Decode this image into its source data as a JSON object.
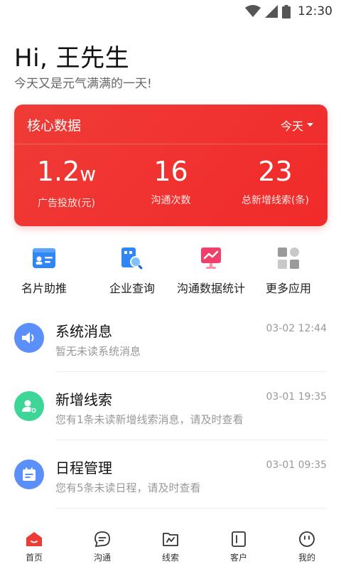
{
  "status_bar": {
    "time": "12:30"
  },
  "header": {
    "greeting": "Hi, 王先生",
    "subtitle": "今天又是元气满满的一天!"
  },
  "core_data": {
    "title": "核心数据",
    "period": "今天",
    "stats": [
      {
        "value": "1.2",
        "unit": "w",
        "label": "广告投放(元)"
      },
      {
        "value": "16",
        "unit": "",
        "label": "沟通次数"
      },
      {
        "value": "23",
        "unit": "",
        "label": "总新增线索(条)"
      }
    ]
  },
  "apps": [
    {
      "label": "名片助推",
      "icon": "business-card-icon"
    },
    {
      "label": "企业查询",
      "icon": "company-search-icon"
    },
    {
      "label": "沟通数据统计",
      "icon": "chart-stats-icon"
    },
    {
      "label": "更多应用",
      "icon": "more-apps-icon"
    }
  ],
  "messages": [
    {
      "title": "系统消息",
      "time": "03-02 12:44",
      "desc": "暂无未读系统消息",
      "icon": "speaker-icon",
      "color": "#5b8ff9"
    },
    {
      "title": "新增线索",
      "time": "03-01 19:35",
      "desc": "您有1条未读新增线索消息，请及时查看",
      "icon": "user-add-icon",
      "color": "#3ed598"
    },
    {
      "title": "日程管理",
      "time": "03-01 09:35",
      "desc": "您有5条未读日程，请及时查看",
      "icon": "calendar-icon",
      "color": "#5b8ff9"
    }
  ],
  "nav": [
    {
      "label": "首页",
      "icon": "home-icon"
    },
    {
      "label": "沟通",
      "icon": "chat-icon"
    },
    {
      "label": "线索",
      "icon": "clue-icon"
    },
    {
      "label": "客户",
      "icon": "customer-icon"
    },
    {
      "label": "我的",
      "icon": "profile-icon"
    }
  ],
  "colors": {
    "accent": "#ef3b36",
    "muted": "#999999"
  }
}
